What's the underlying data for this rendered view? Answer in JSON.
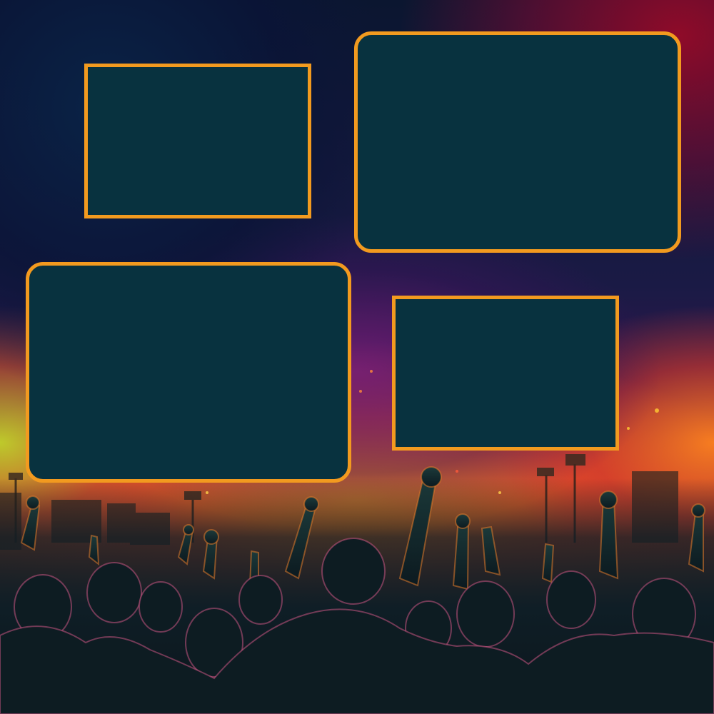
{
  "colors": {
    "panel_fill": "#08323f",
    "panel_border": "#f29a1f",
    "crowd_silhouette": "#0f1e26",
    "glow_orange": "#ff9a2a",
    "glow_magenta": "#c0308a",
    "sky_red": "#96102a",
    "sky_navy": "#0b1630"
  },
  "panels": [
    {
      "name": "photo-frame-top-left",
      "shape": "square-corners"
    },
    {
      "name": "photo-frame-top-right",
      "shape": "rounded-corners"
    },
    {
      "name": "photo-frame-bottom-left",
      "shape": "rounded-corners"
    },
    {
      "name": "photo-frame-bottom-right",
      "shape": "square-corners"
    }
  ]
}
